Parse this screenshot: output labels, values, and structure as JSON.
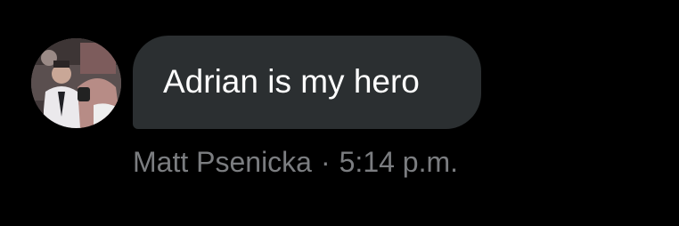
{
  "message": {
    "text": "Adrian is my hero",
    "sender": "Matt Psenicka",
    "separator": "·",
    "time": "5:14 p.m."
  },
  "avatar": {
    "icon": "user-avatar-photo"
  },
  "colors": {
    "background": "#000000",
    "bubble": "#2b2f31",
    "bubble_text": "#ffffff",
    "meta_text": "#7b7d80"
  }
}
